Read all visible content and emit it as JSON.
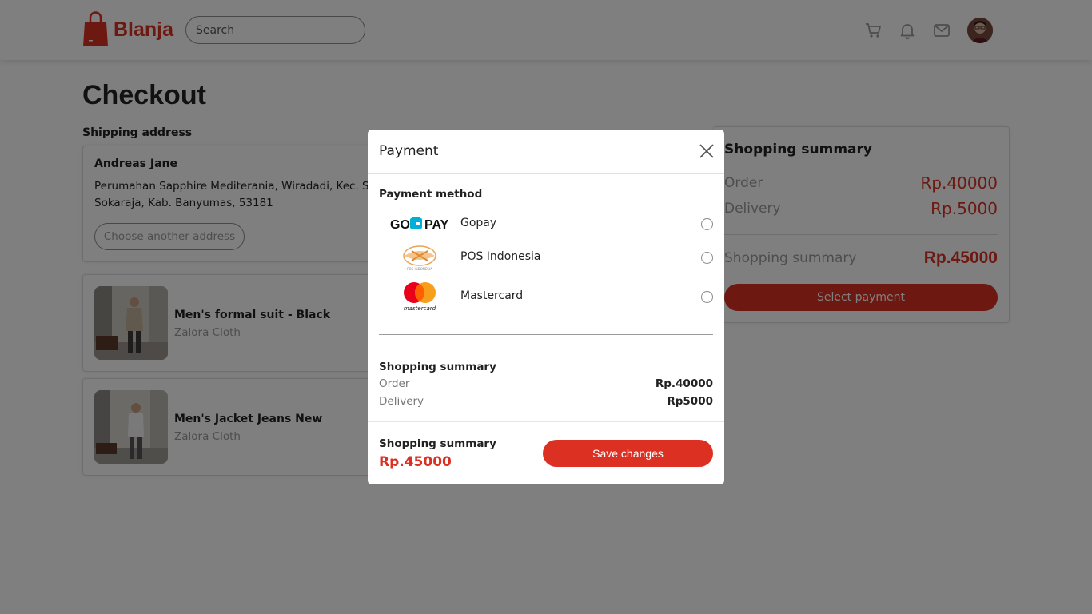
{
  "header": {
    "brand": "Blanja",
    "search_placeholder": "Search",
    "icons": [
      "cart-icon",
      "bell-icon",
      "mail-icon"
    ]
  },
  "page": {
    "title": "Checkout",
    "shipping_label": "Shipping address",
    "address": {
      "name": "Andreas Jane",
      "line1": "Perumahan Sapphire Mediterania, Wiradadi, Kec. Sokaraja,",
      "line2": "Sokaraja, Kab. Banyumas, 53181",
      "button": "Choose another address"
    },
    "products": [
      {
        "name": "Men's formal suit - Black",
        "store": "Zalora Cloth"
      },
      {
        "name": "Men's Jacket Jeans New",
        "store": "Zalora Cloth"
      }
    ],
    "summary": {
      "title": "Shopping summary",
      "order_label": "Order",
      "order_value": "Rp.40000",
      "delivery_label": "Delivery",
      "delivery_value": "Rp.5000",
      "total_label": "Shopping summary",
      "total_value": "Rp.45000",
      "button": "Select payment"
    }
  },
  "modal": {
    "title": "Payment",
    "method_label": "Payment method",
    "methods": [
      {
        "name": "Gopay",
        "logo_text": "GO PAY",
        "selected": false
      },
      {
        "name": "POS Indonesia",
        "logo_text": "POS INDONESIA",
        "selected": false
      },
      {
        "name": "Mastercard",
        "logo_text": "mastercard",
        "selected": false
      }
    ],
    "summary_title": "Shopping summary",
    "order_label": "Order",
    "order_value": "Rp.40000",
    "delivery_label": "Delivery",
    "delivery_value": "Rp5000",
    "total_label": "Shopping summary",
    "total_value": "Rp.45000",
    "save_button": "Save changes"
  },
  "colors": {
    "brand": "#db3022",
    "muted": "#9b9b9b",
    "overlay": "rgba(0,0,0,0.5)"
  }
}
